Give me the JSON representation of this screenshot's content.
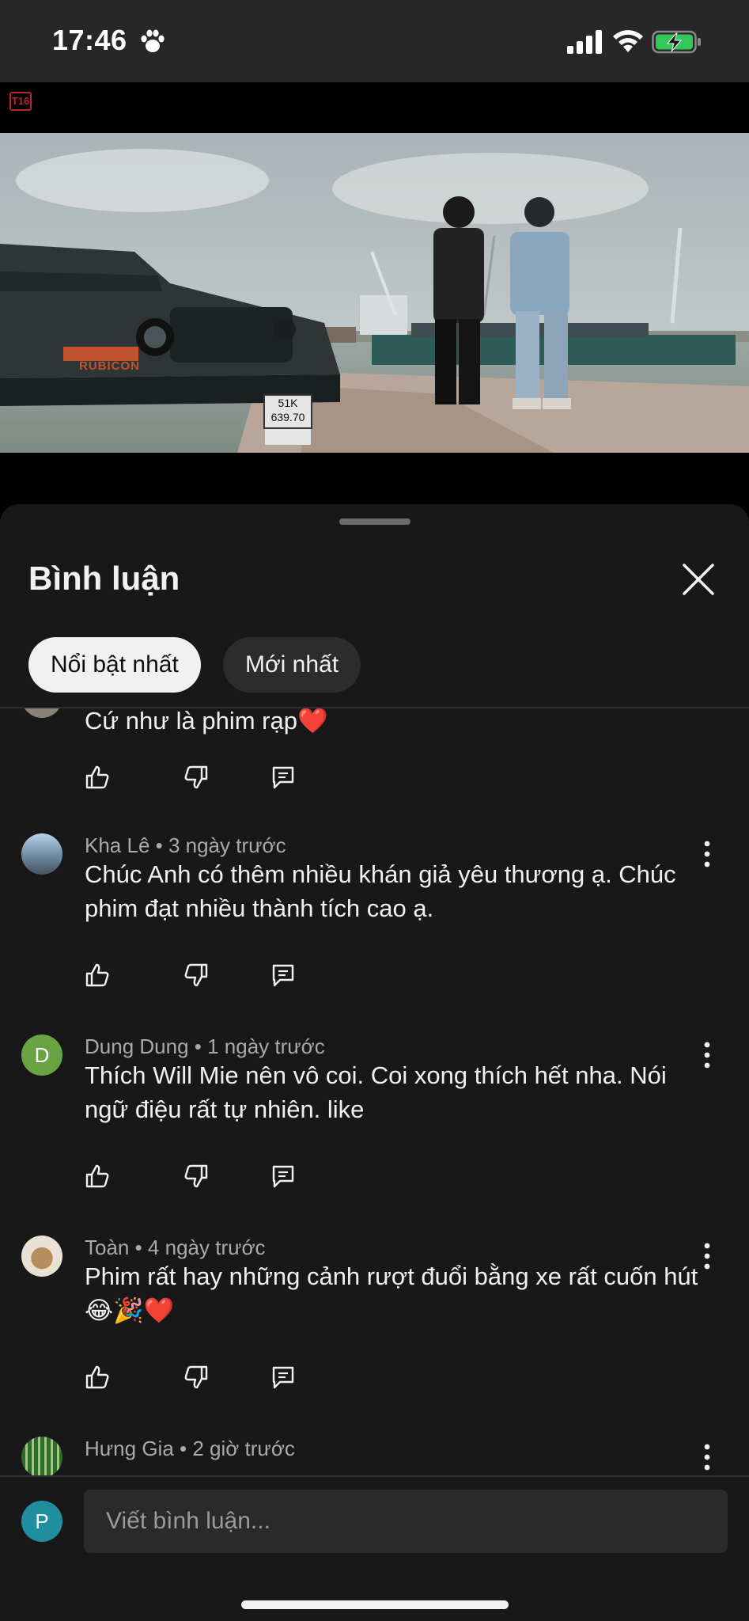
{
  "status_bar": {
    "time": "17:46",
    "icons": [
      "paw-icon",
      "signal-icon",
      "wifi-icon",
      "battery-charging-icon"
    ]
  },
  "video": {
    "rating_badge": "T16",
    "plate_line1": "51K",
    "plate_line2": "639.70",
    "jeep_badge": "RUBICON",
    "progress_fraction": 0.065
  },
  "comments_panel": {
    "title": "Bình luận",
    "close_icon": "close-icon",
    "filters": [
      {
        "label": "Nổi bật nhất",
        "active": true
      },
      {
        "label": "Mới nhất",
        "active": false
      }
    ],
    "comments": [
      {
        "author": "",
        "time": "",
        "meta": "",
        "text": "Cứ như là phim rạp❤️",
        "avatar": "photo"
      },
      {
        "author": "Kha Lê",
        "time": "3 ngày trước",
        "meta": "Kha Lê • 3 ngày trước",
        "text": "Chúc Anh có thêm nhiều khán giả yêu thương ạ. Chúc phim đạt nhiều thành tích cao ạ.",
        "avatar": "photo"
      },
      {
        "author": "Dung Dung",
        "time": "1 ngày trước",
        "meta": "Dung Dung • 1 ngày trước",
        "text": "Thích Will Mie nên vô coi. Coi xong thích hết nha. Nói ngữ điệu rất tự nhiên. like",
        "avatar": "D"
      },
      {
        "author": "Toàn",
        "time": "4 ngày trước",
        "meta": "Toàn • 4 ngày trước",
        "text": "Phim rất hay những cảnh rượt đuổi bằng xe rất cuốn hút😂🎉❤️",
        "avatar": "photo"
      },
      {
        "author": "Hưng Gia",
        "time": "2 giờ trước",
        "meta": "Hưng Gia • 2 giờ trước",
        "text": "",
        "avatar": "photo"
      }
    ],
    "action_icons": [
      "thumbs-up-icon",
      "thumbs-down-icon",
      "reply-icon"
    ]
  },
  "composer": {
    "avatar_letter": "P",
    "placeholder": "Viết bình luận..."
  },
  "colors": {
    "background": "#181818",
    "status_bar": "#272727",
    "progress": "#e3001b",
    "chip_active": "#f1f1f1",
    "chip_inactive": "#2c2c2c",
    "avatar_d": "#6aa341",
    "avatar_p": "#1f8fa0"
  }
}
